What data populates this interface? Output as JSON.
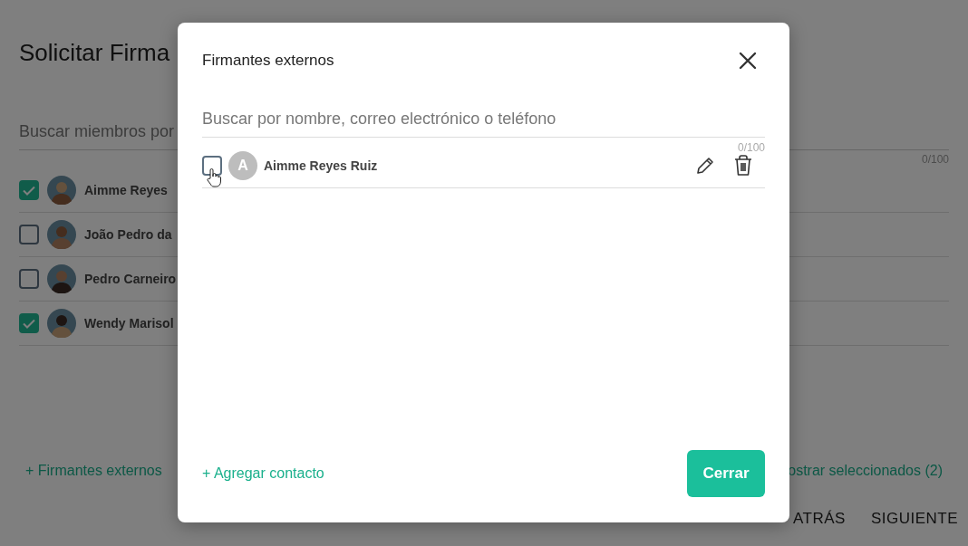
{
  "page": {
    "title": "Solicitar Firma",
    "search": {
      "placeholder": "Buscar miembros por"
    },
    "counter": "0/100",
    "members": [
      {
        "name": "Aimme Reyes",
        "checked": true
      },
      {
        "name": "João Pedro da",
        "checked": false
      },
      {
        "name": "Pedro Carneiro",
        "checked": false
      },
      {
        "name": "Wendy Marisol",
        "checked": true
      }
    ],
    "add_external": "+ Firmantes externos",
    "show_selected": "ostrar seleccionados (2)",
    "actions": [
      "ATRÁS",
      "SIGUIENTE"
    ]
  },
  "dialog": {
    "title": "Firmantes externos",
    "search": {
      "placeholder": "Buscar por nombre, correo electrónico o teléfono"
    },
    "counter": "0/100",
    "contacts": [
      {
        "initial": "A",
        "name": "Aimme Reyes Ruiz",
        "checked": false
      }
    ],
    "add_contact": "+ Agregar contacto",
    "close_button": "Cerrar"
  }
}
